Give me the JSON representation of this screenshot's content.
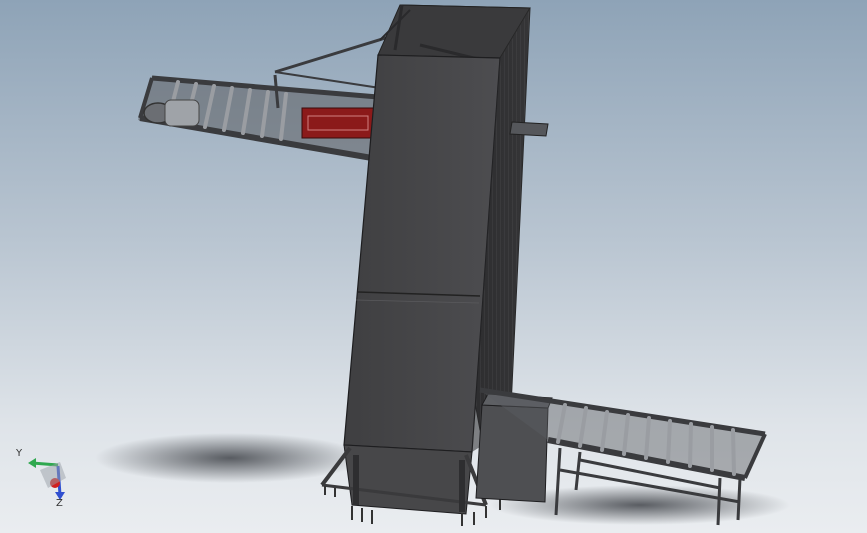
{
  "viewport": {
    "background_top": "#8ea3b7",
    "background_bottom": "#eaedf0"
  },
  "model": {
    "tower_color": "#4a4a4c",
    "frame_color": "#3d3d3f",
    "roller_color": "#8a8d92",
    "motor_color": "#8b1a1a"
  },
  "triad": {
    "y_label": "Y",
    "z_label": "Z",
    "y_color": "#2fa84f",
    "z_color": "#3050d0",
    "x_color": "#d02020"
  }
}
